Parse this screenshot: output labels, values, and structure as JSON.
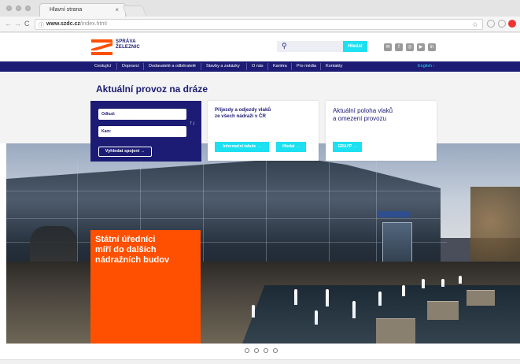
{
  "browser": {
    "tab_title": "Hlavní strana",
    "tab_close": "×",
    "url_host": "www.szdc.cz",
    "url_path": "/index.html",
    "icons": [
      "back-icon",
      "forward-icon",
      "reload-icon",
      "info-icon",
      "star-icon"
    ]
  },
  "header": {
    "logo_line1": "SPRÁVA",
    "logo_line2": "ŽELEZNIC",
    "search_placeholder": "",
    "search_button": "Hledat",
    "social_icons": [
      "email-icon",
      "facebook-icon",
      "instagram-icon",
      "youtube-icon",
      "linkedin-icon"
    ]
  },
  "nav": {
    "items": [
      "Cestující",
      "Dopravci",
      "Dodavatelé a odběratelé",
      "Stavby a zakázky",
      "O nás",
      "Kariéra",
      "Pro média",
      "Kontakty"
    ],
    "lang": "English ›"
  },
  "provoz": {
    "title": "Aktuální provoz na dráze",
    "from_label": "Odkud:",
    "to_label": "Kam:",
    "swap": "↑↓",
    "search_button": "Vyhledat spojení →",
    "card1_title": "Příjezdy a odjezdy vlaků\nze všech nádraží v ČR",
    "card1_btn1": "Informační tabule →",
    "card1_btn2": "Hledat →",
    "card2_title": "Aktuální poloha vlaků\na omezení provozu",
    "card2_btn": "GRAPP →"
  },
  "hero": {
    "caption": "Státní úředníci\nmíří do dalších\nnádražních budov",
    "slides": 4
  },
  "colors": {
    "navy": "#1c1c75",
    "orange": "#fe5000",
    "cyan": "#1de0f0"
  }
}
